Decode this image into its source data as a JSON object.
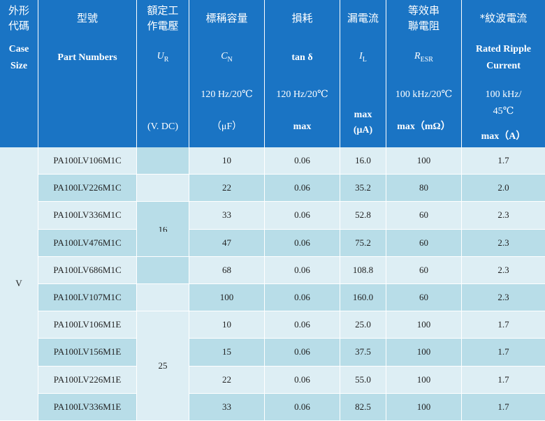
{
  "headers": {
    "row1": [
      "外形\n代碼",
      "型號",
      "額定工\n作電壓",
      "標稱容量",
      "損耗",
      "漏電流",
      "等效串\n聯電阻",
      "*紋波電流"
    ],
    "row2": {
      "case": "Case\nSize",
      "part": "Part Numbers",
      "ur": "U",
      "ur_sub": "R",
      "cn": "C",
      "cn_sub": "N",
      "tan": "tan δ",
      "il": "I",
      "il_sub": "L",
      "resr": "R",
      "resr_sub": "ESR",
      "ripple": "Rated Ripple\nCurrent"
    },
    "row3": {
      "ur_unit": "(V. DC)",
      "cn_cond": "120 Hz/20℃",
      "cn_unit": "（μF）",
      "tan_cond": "120 Hz/20℃",
      "tan_unit": "max",
      "il_unit": "max\n(μA)",
      "resr_cond": "100 kHz/20℃",
      "resr_unit": "max（mΩ）",
      "ripple_cond": "100 kHz/\n45℃",
      "ripple_unit": "max（A）"
    }
  },
  "case_code": "V",
  "voltage_16": "16",
  "voltage_25": "25",
  "rows": [
    {
      "part": "PA100LV106M1C",
      "cap": "10",
      "tan": "0.06",
      "leak": "16.0",
      "esr": "100",
      "ripple": "1.7"
    },
    {
      "part": "PA100LV226M1C",
      "cap": "22",
      "tan": "0.06",
      "leak": "35.2",
      "esr": "80",
      "ripple": "2.0"
    },
    {
      "part": "PA100LV336M1C",
      "cap": "33",
      "tan": "0.06",
      "leak": "52.8",
      "esr": "60",
      "ripple": "2.3"
    },
    {
      "part": "PA100LV476M1C",
      "cap": "47",
      "tan": "0.06",
      "leak": "75.2",
      "esr": "60",
      "ripple": "2.3"
    },
    {
      "part": "PA100LV686M1C",
      "cap": "68",
      "tan": "0.06",
      "leak": "108.8",
      "esr": "60",
      "ripple": "2.3"
    },
    {
      "part": "PA100LV107M1C",
      "cap": "100",
      "tan": "0.06",
      "leak": "160.0",
      "esr": "60",
      "ripple": "2.3"
    },
    {
      "part": "PA100LV106M1E",
      "cap": "10",
      "tan": "0.06",
      "leak": "25.0",
      "esr": "100",
      "ripple": "1.7"
    },
    {
      "part": "PA100LV156M1E",
      "cap": "15",
      "tan": "0.06",
      "leak": "37.5",
      "esr": "100",
      "ripple": "1.7"
    },
    {
      "part": "PA100LV226M1E",
      "cap": "22",
      "tan": "0.06",
      "leak": "55.0",
      "esr": "100",
      "ripple": "1.7"
    },
    {
      "part": "PA100LV336M1E",
      "cap": "33",
      "tan": "0.06",
      "leak": "82.5",
      "esr": "100",
      "ripple": "1.7"
    }
  ]
}
